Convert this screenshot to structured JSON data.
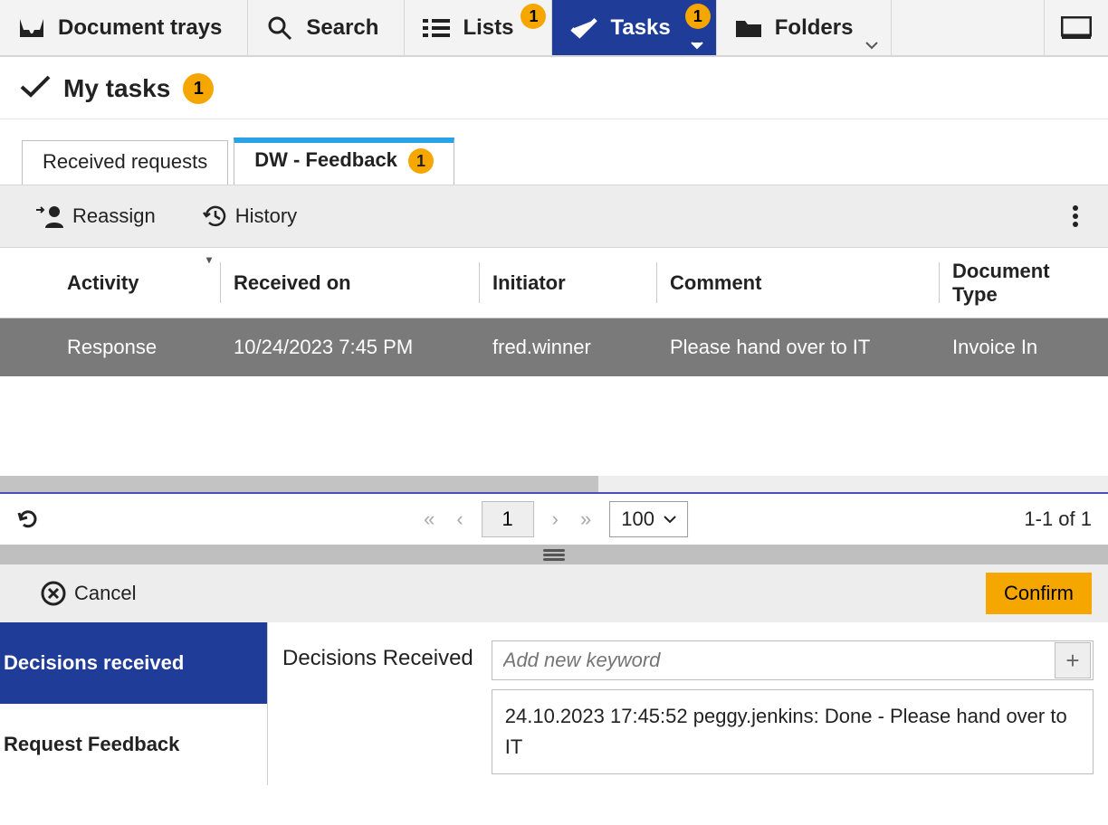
{
  "topnav": {
    "items": [
      {
        "label": "Document trays",
        "badge": null
      },
      {
        "label": "Search",
        "badge": null
      },
      {
        "label": "Lists",
        "badge": "1"
      },
      {
        "label": "Tasks",
        "badge": "1",
        "active": true
      },
      {
        "label": "Folders",
        "badge": null
      }
    ]
  },
  "page": {
    "title": "My tasks",
    "badge": "1"
  },
  "subtabs": [
    {
      "label": "Received requests",
      "badge": null,
      "active": false
    },
    {
      "label": "DW - Feedback",
      "badge": "1",
      "active": true
    }
  ],
  "toolbar": {
    "reassign": "Reassign",
    "history": "History"
  },
  "table": {
    "columns": {
      "activity": "Activity",
      "received": "Received on",
      "initiator": "Initiator",
      "comment": "Comment",
      "doctype": "Document Type"
    },
    "rows": [
      {
        "activity": "Response",
        "received": "10/24/2023 7:45 PM",
        "initiator": "fred.winner",
        "comment": "Please hand over to IT",
        "doctype": "Invoice In"
      }
    ]
  },
  "pager": {
    "page": "1",
    "size": "100",
    "range": "1-1 of 1"
  },
  "actions": {
    "cancel": "Cancel",
    "confirm": "Confirm"
  },
  "bottom": {
    "side": [
      {
        "label": "Decisions received",
        "active": true
      },
      {
        "label": "Request Feedback",
        "active": false
      }
    ],
    "detail": {
      "label": "Decisions Received",
      "keyword_placeholder": "Add new keyword",
      "entry": "24.10.2023 17:45:52 peggy.jenkins: Done - Please hand over to IT"
    }
  }
}
